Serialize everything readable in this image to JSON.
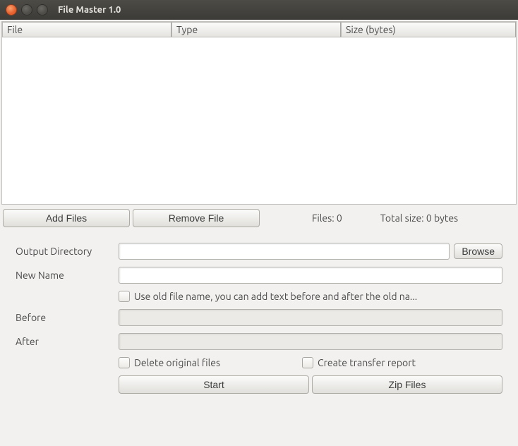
{
  "window": {
    "title": "File Master 1.0"
  },
  "table": {
    "columns": {
      "file": "File",
      "type": "Type",
      "size": "Size (bytes)"
    },
    "rows": []
  },
  "toolbar": {
    "add_files": "Add Files",
    "remove_file": "Remove File"
  },
  "status": {
    "files_label": "Files:",
    "files_count": "0",
    "total_size_label": "Total size:",
    "total_size_value": "0 bytes"
  },
  "form": {
    "output_directory_label": "Output Directory",
    "output_directory_value": "",
    "browse_label": "Browse",
    "new_name_label": "New Name",
    "new_name_value": "",
    "use_old_name_label": "Use old file name, you can add text before and after the old na...",
    "before_label": "Before",
    "before_value": "",
    "after_label": "After",
    "after_value": "",
    "delete_originals_label": "Delete original files",
    "create_report_label": "Create transfer report",
    "start_label": "Start",
    "zip_label": "Zip Files"
  }
}
